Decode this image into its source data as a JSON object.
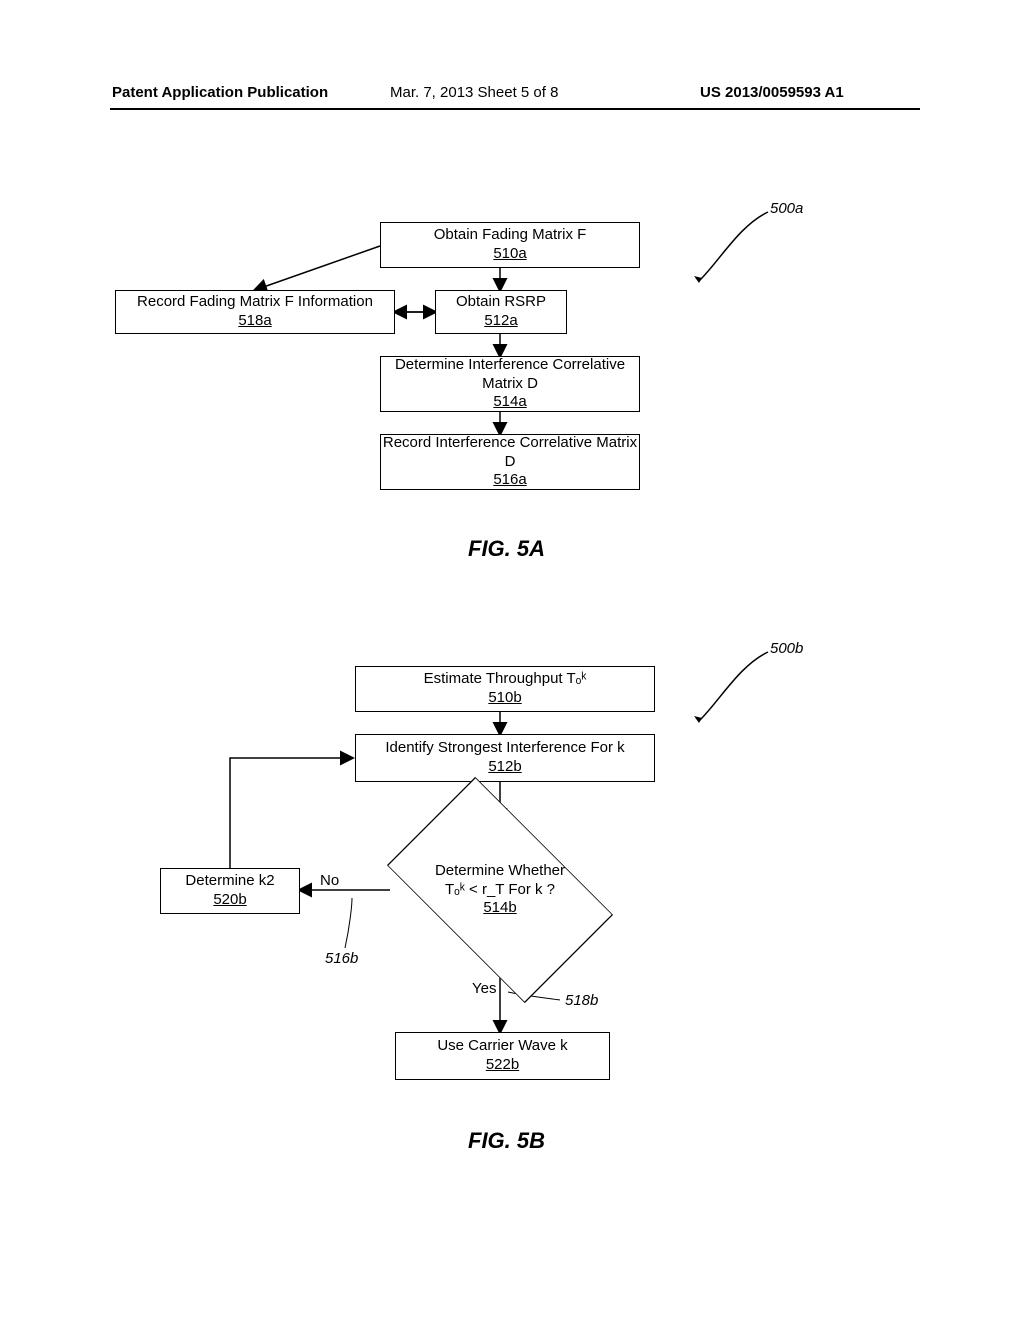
{
  "header": {
    "left": "Patent Application Publication",
    "mid": "Mar. 7, 2013   Sheet 5 of 8",
    "right": "US 2013/0059593 A1"
  },
  "fig5a": {
    "pointer": "500a",
    "caption": "FIG. 5A",
    "boxes": {
      "b510a": {
        "text": "Obtain Fading Matrix F",
        "ref": "510a"
      },
      "b512a": {
        "text": "Obtain RSRP",
        "ref": "512a"
      },
      "b518a": {
        "text": "Record Fading Matrix F Information",
        "ref": "518a"
      },
      "b514a": {
        "text": "Determine Interference Correlative Matrix D",
        "ref": "514a"
      },
      "b516a": {
        "text": "Record Interference Correlative Matrix D",
        "ref": "516a"
      }
    }
  },
  "fig5b": {
    "pointer": "500b",
    "caption": "FIG. 5B",
    "boxes": {
      "b510b": {
        "text": "Estimate Throughput Tₒᵏ",
        "ref": "510b"
      },
      "b512b": {
        "text": "Identify Strongest Interference For k",
        "ref": "512b"
      },
      "b520b": {
        "text": "Determine k2",
        "ref": "520b"
      },
      "b522b": {
        "text": "Use Carrier Wave k",
        "ref": "522b"
      }
    },
    "diamond": {
      "text1": "Determine Whether",
      "text2": "Tₒᵏ  < r_T For k ?",
      "ref": "514b"
    },
    "labels": {
      "no": "No",
      "yes": "Yes",
      "l516b": "516b",
      "l518b": "518b"
    }
  }
}
